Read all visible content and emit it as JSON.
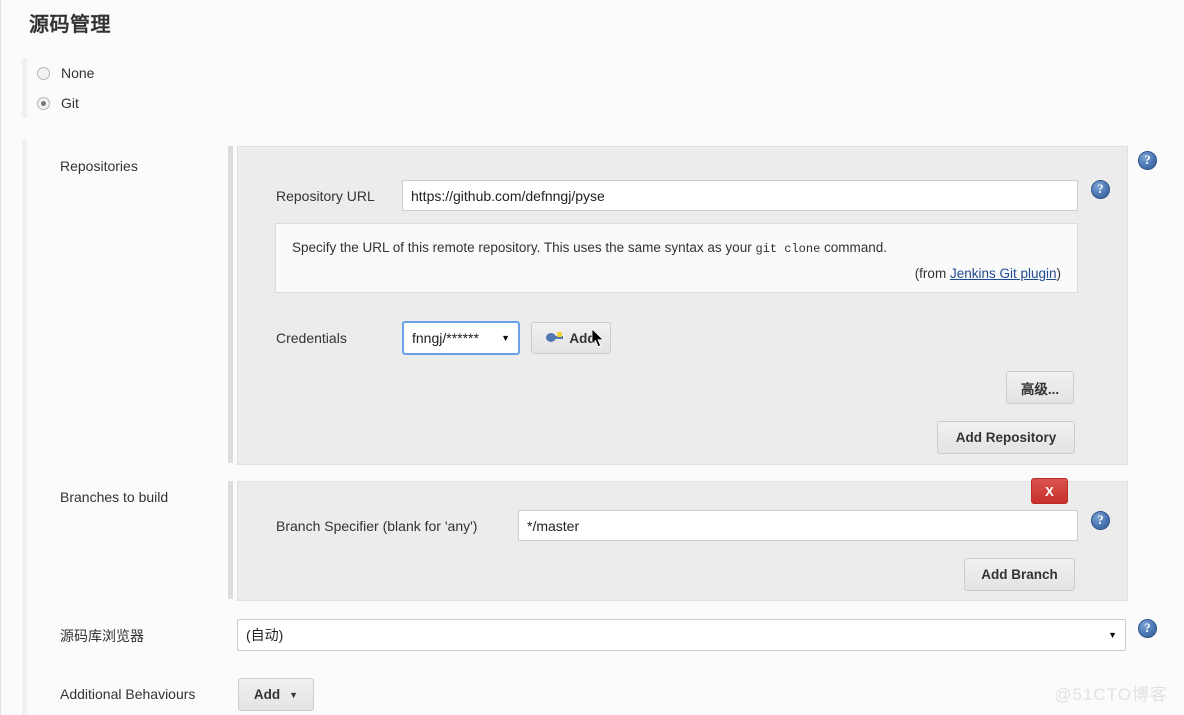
{
  "page": {
    "title": "源码管理",
    "watermark": "@51CTO博客"
  },
  "scm_type": {
    "options": [
      {
        "label": "None",
        "selected": false
      },
      {
        "label": "Git",
        "selected": true
      }
    ],
    "none_label": "None",
    "git_label": "Git"
  },
  "rows": {
    "repositories_label": "Repositories",
    "branches_label": "Branches to build",
    "browser_label": "源码库浏览器",
    "additional_label": "Additional Behaviours"
  },
  "repository": {
    "url_label": "Repository URL",
    "url_value": "https://github.com/defnngj/pyse",
    "help_text_1": "Specify the URL of this remote repository. This uses the same syntax as your ",
    "help_text_mono": "git clone",
    "help_text_2": " command.",
    "help_from_prefix": "(from ",
    "help_from_link": "Jenkins Git plugin",
    "help_from_suffix": ")",
    "credentials_label": "Credentials",
    "credentials_value": "fnngj/******",
    "add_credentials_label": "Add",
    "advanced_label": "高级...",
    "add_repository_label": "Add Repository"
  },
  "branches": {
    "specifier_label": "Branch Specifier (blank for 'any')",
    "specifier_value": "*/master",
    "delete_label": "X",
    "add_branch_label": "Add Branch"
  },
  "browser": {
    "value": "(自动)",
    "caret": "▼"
  },
  "additional": {
    "add_label": "Add",
    "caret": "▼"
  },
  "icons": {
    "help": "?",
    "caret_down": "▼"
  },
  "colors": {
    "accent_blue": "#4c77b3",
    "danger_red": "#c9302c",
    "link_blue": "#214a94",
    "panel_gray": "#ececec",
    "page_bg": "#fbfbfb"
  }
}
